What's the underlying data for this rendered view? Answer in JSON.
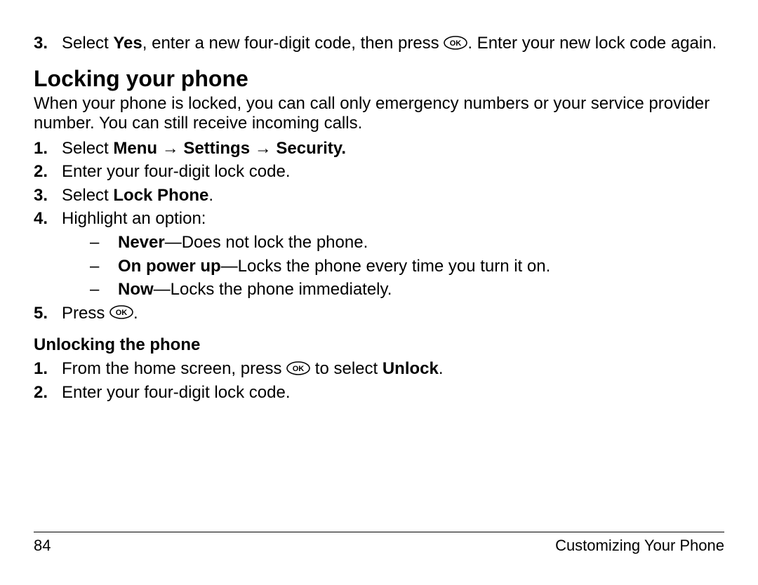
{
  "top_step": {
    "num": "3.",
    "text_before": "Select ",
    "bold1": "Yes",
    "text_mid": ", enter a new four-digit code, then press ",
    "text_after": ". Enter your new lock code again."
  },
  "section_title": "Locking your phone",
  "intro": "When your phone is locked, you can call only emergency numbers or your service provider number. You can still receive incoming calls.",
  "steps": {
    "s1": {
      "num": "1.",
      "prefix": "Select ",
      "bold": "Menu → Settings → Security."
    },
    "s2": {
      "num": "2.",
      "text": "Enter your four-digit lock code."
    },
    "s3": {
      "num": "3.",
      "prefix": "Select ",
      "bold": "Lock Phone",
      "suffix": "."
    },
    "s4": {
      "num": "4.",
      "text": "Highlight an option:"
    },
    "s5": {
      "num": "5.",
      "prefix": "Press ",
      "suffix": "."
    }
  },
  "options": {
    "o1": {
      "dash": "–",
      "bold": "Never",
      "rest": "—Does not lock the phone."
    },
    "o2": {
      "dash": "–",
      "bold": "On power up",
      "rest": "—Locks the phone every time you turn it on."
    },
    "o3": {
      "dash": "–",
      "bold": "Now",
      "rest": "—Locks the phone immediately."
    }
  },
  "subsection_title": "Unlocking the phone",
  "unlock": {
    "u1": {
      "num": "1.",
      "prefix": "From the home screen, press ",
      "mid": " to select ",
      "bold": "Unlock",
      "suffix": "."
    },
    "u2": {
      "num": "2.",
      "text": "Enter your four-digit lock code."
    }
  },
  "footer": {
    "page": "84",
    "chapter": "Customizing Your Phone"
  }
}
